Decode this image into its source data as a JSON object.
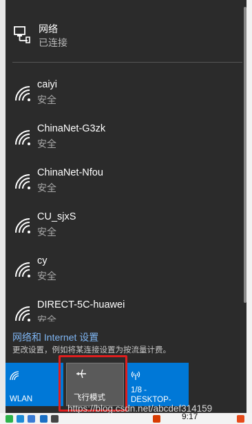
{
  "network": {
    "title": "网络",
    "status": "已连接",
    "icon": "ethernet-icon"
  },
  "wifi_list": [
    {
      "name": "caiyi",
      "status": "安全"
    },
    {
      "name": "ChinaNet-G3zk",
      "status": "安全"
    },
    {
      "name": "ChinaNet-Nfou",
      "status": "安全"
    },
    {
      "name": "CU_sjxS",
      "status": "安全"
    },
    {
      "name": "cy",
      "status": "安全"
    },
    {
      "name": "DIRECT-5C-huawei",
      "status": "安全"
    }
  ],
  "settings": {
    "link": "网络和 Internet 设置",
    "description": "更改设置，例如将某连接设置为按流量计费。"
  },
  "tiles": {
    "wlan": "WLAN",
    "airplane": "飞行模式",
    "hotspot": "1/8 - DESKTOP-"
  },
  "taskbar": {
    "time": "9:17"
  },
  "watermark": "https://blog.csdn.net/abcdef314159",
  "colors": {
    "accent": "#0078d7",
    "highlight": "#e01e1e",
    "link": "#7fb6f3"
  }
}
